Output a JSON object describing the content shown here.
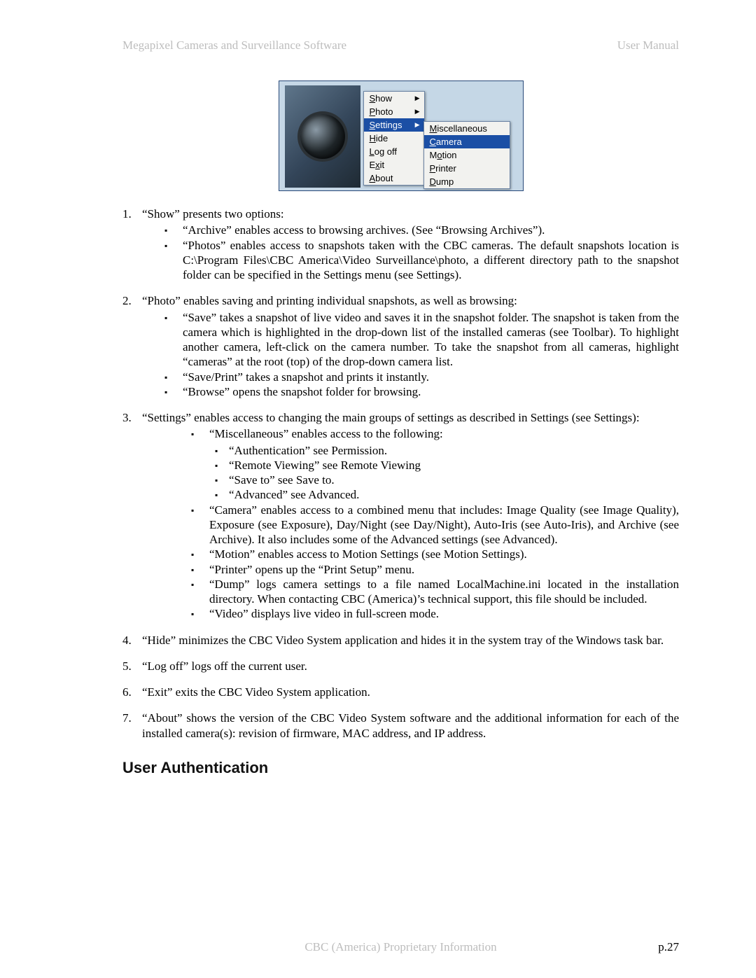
{
  "header": {
    "left": "Megapixel Cameras and Surveillance Software",
    "right": "User Manual"
  },
  "screenshot": {
    "menu": {
      "items": [
        {
          "u": "S",
          "rest": "how",
          "arrow": true,
          "sel": false
        },
        {
          "u": "P",
          "rest": "hoto",
          "arrow": true,
          "sel": false
        },
        {
          "u": "S",
          "rest": "ettings",
          "arrow": true,
          "sel": true
        },
        {
          "u": "H",
          "rest": "ide",
          "arrow": false,
          "sel": false
        },
        {
          "u": "L",
          "rest": "og off",
          "arrow": false,
          "sel": false
        },
        {
          "u": "",
          "rest": "E",
          "mid_u": "x",
          "tail": "it",
          "arrow": false,
          "sel": false
        },
        {
          "u": "A",
          "rest": "bout",
          "arrow": false,
          "sel": false
        }
      ],
      "submenu": [
        {
          "u": "M",
          "rest": "iscellaneous",
          "sel": false
        },
        {
          "u": "C",
          "rest": "amera",
          "sel": true
        },
        {
          "u": "",
          "rest": "M",
          "mid_u": "o",
          "tail": "tion",
          "sel": false
        },
        {
          "u": "P",
          "rest": "rinter",
          "sel": false
        },
        {
          "u": "D",
          "rest": "ump",
          "sel": false
        }
      ]
    }
  },
  "list": [
    {
      "n": "1.",
      "lead": "“Show” presents two options:",
      "bullets": [
        "“Archive” enables access to browsing archives. (See “Browsing Archives”).",
        "“Photos” enables access to snapshots taken with the CBC cameras.  The default snapshots location is C:\\Program Files\\CBC America\\Video Surveillance\\photo, a different directory path to the snapshot folder can be specified in the Settings menu (see Settings)."
      ]
    },
    {
      "n": "2.",
      "lead": "“Photo” enables saving and printing individual snapshots, as well as browsing:",
      "bullets": [
        "“Save” takes a snapshot of live video and saves it in the snapshot folder.  The snapshot is taken from the camera which is highlighted in the drop-down list of the installed cameras (see Toolbar).  To highlight another camera, left-click on the camera number.  To take the snapshot from all cameras, highlight “cameras” at the root (top) of the drop-down camera list.",
        "“Save/Print” takes a snapshot and prints it instantly.",
        "“Browse” opens the snapshot folder for browsing."
      ]
    },
    {
      "n": "3.",
      "lead": "“Settings” enables access to changing the main groups of settings as described in Settings (see Settings):",
      "indent": true,
      "bullets_rich": [
        {
          "text": "“Miscellaneous” enables access to the following:",
          "sub": [
            "“Authentication” see Permission.",
            "“Remote Viewing” see Remote Viewing",
            "“Save to” see Save to.",
            "“Advanced” see Advanced."
          ]
        },
        {
          "text": "“Camera” enables access to a combined menu that includes: Image Quality (see Image Quality), Exposure (see Exposure), Day/Night (see Day/Night), Auto-Iris (see Auto-Iris), and Archive (see Archive).  It also includes some of the Advanced settings (see Advanced)."
        },
        {
          "text": "“Motion” enables access to Motion Settings (see Motion Settings)."
        },
        {
          "text": "“Printer” opens up the “Print Setup” menu."
        },
        {
          "text": "“Dump” logs camera settings to a file named LocalMachine.ini located in the installation directory.  When contacting CBC (America)’s technical support, this file should be included."
        },
        {
          "text": "“Video” displays live video in full-screen mode."
        }
      ]
    },
    {
      "n": "4.",
      "lead": " “Hide” minimizes the CBC Video System application and hides it in the system tray of the Windows task bar."
    },
    {
      "n": "5.",
      "lead": "“Log off” logs off the current user."
    },
    {
      "n": "6.",
      "lead": "“Exit” exits the CBC Video System application."
    },
    {
      "n": "7.",
      "lead": "“About” shows the version of the CBC Video System software and the additional information for each of the installed camera(s):  revision of firmware, MAC address, and IP address."
    }
  ],
  "section_heading": "User Authentication",
  "footer": {
    "center": "CBC (America) Proprietary Information",
    "page": "p.27"
  }
}
